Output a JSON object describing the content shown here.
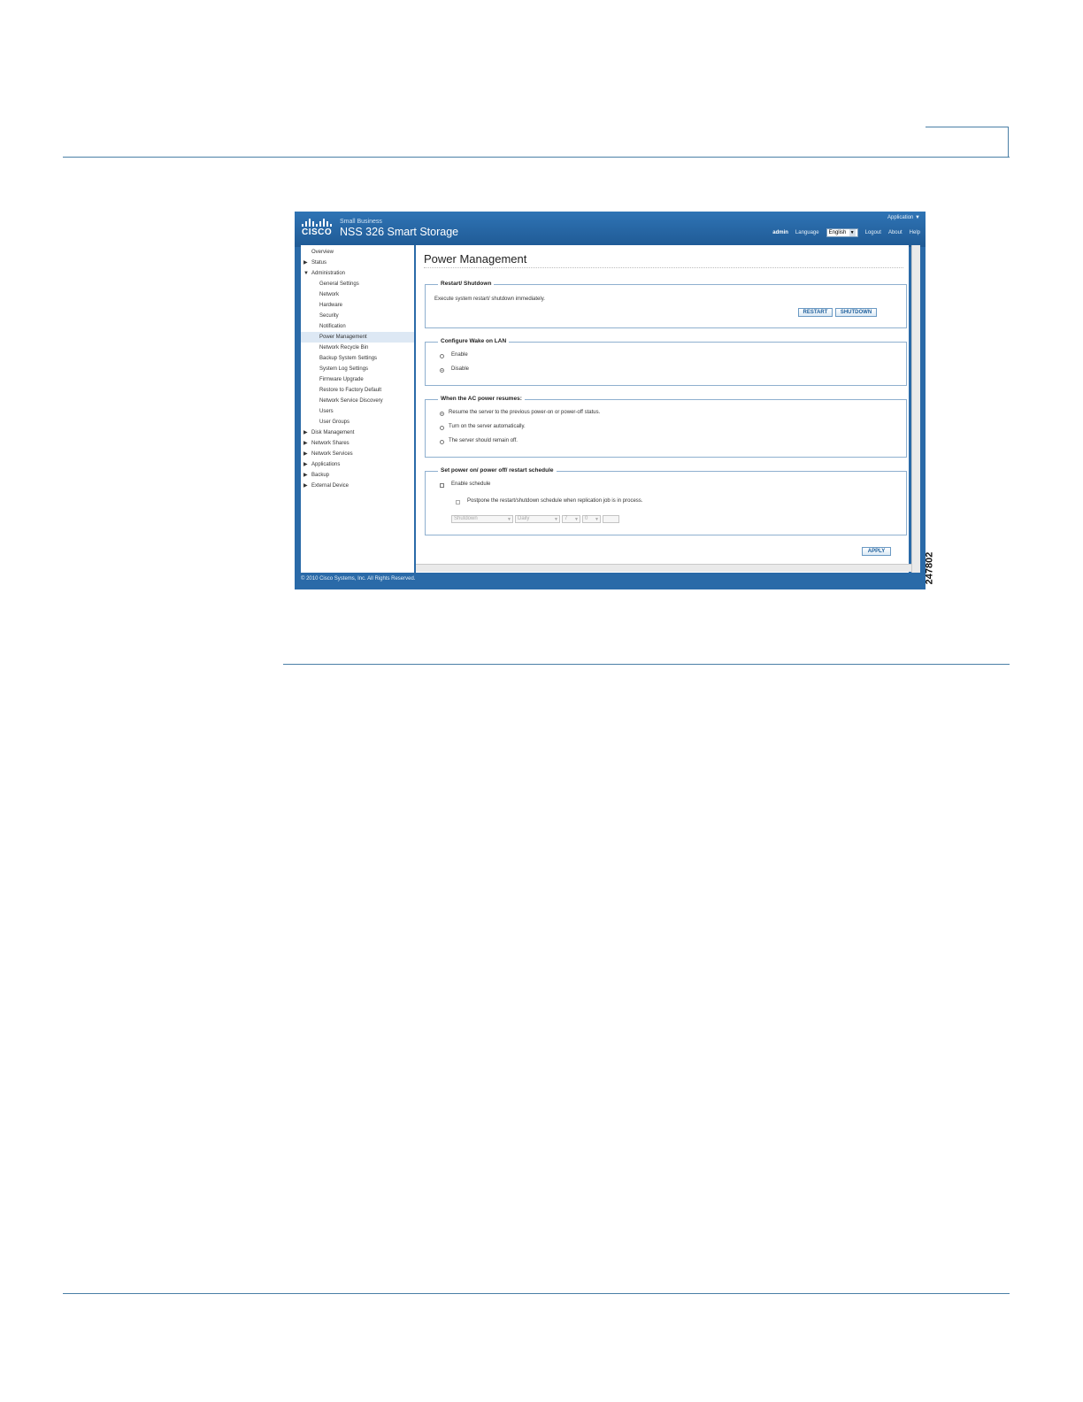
{
  "app": {
    "brand_small": "Small Business",
    "brand_title": "NSS 326 Smart Storage",
    "application_menu": "Application ▼",
    "user": "admin",
    "language_label": "Language",
    "language_value": "English",
    "logout": "Logout",
    "about": "About",
    "help": "Help",
    "logo_word": "CISCO"
  },
  "sidebar": {
    "items": [
      {
        "label": "Overview",
        "level": 0,
        "icon": ""
      },
      {
        "label": "Status",
        "level": 0,
        "icon": "triangle-right"
      },
      {
        "label": "Administration",
        "level": 0,
        "icon": "triangle-down"
      },
      {
        "label": "General Settings",
        "level": 1
      },
      {
        "label": "Network",
        "level": 1
      },
      {
        "label": "Hardware",
        "level": 1
      },
      {
        "label": "Security",
        "level": 1
      },
      {
        "label": "Notification",
        "level": 1
      },
      {
        "label": "Power Management",
        "level": 1,
        "active": true
      },
      {
        "label": "Network Recycle Bin",
        "level": 1
      },
      {
        "label": "Backup System Settings",
        "level": 1
      },
      {
        "label": "System Log Settings",
        "level": 1
      },
      {
        "label": "Firmware Upgrade",
        "level": 1
      },
      {
        "label": "Restore to Factory Default",
        "level": 1
      },
      {
        "label": "Network Service Discovery",
        "level": 1
      },
      {
        "label": "Users",
        "level": 1
      },
      {
        "label": "User Groups",
        "level": 1
      },
      {
        "label": "Disk Management",
        "level": 0,
        "icon": "triangle-right"
      },
      {
        "label": "Network Shares",
        "level": 0,
        "icon": "triangle-right"
      },
      {
        "label": "Network Services",
        "level": 0,
        "icon": "triangle-right"
      },
      {
        "label": "Applications",
        "level": 0,
        "icon": "triangle-right"
      },
      {
        "label": "Backup",
        "level": 0,
        "icon": "triangle-right"
      },
      {
        "label": "External Device",
        "level": 0,
        "icon": "triangle-right"
      }
    ]
  },
  "main": {
    "title": "Power Management",
    "restart_shutdown": {
      "legend": "Restart/ Shutdown",
      "description": "Execute system restart/ shutdown immediately.",
      "restart_label": "RESTART",
      "shutdown_label": "SHUTDOWN"
    },
    "wake_on_lan": {
      "legend": "Configure Wake on LAN",
      "options": [
        "Enable",
        "Disable"
      ],
      "selected": "Disable"
    },
    "ac_power": {
      "legend": "When the AC power resumes:",
      "options": [
        "Resume the server to the previous power-on or power-off status.",
        "Turn on the server automatically.",
        "The server should remain off."
      ],
      "selected": "Resume the server to the previous power-on or power-off status."
    },
    "schedule": {
      "legend": "Set power on/ power off/ restart schedule",
      "enable_label": "Enable schedule",
      "enable_checked": false,
      "postpone_label": "Postpone the restart/shutdown schedule when replication job is in process.",
      "postpone_checked": false,
      "action_value": "Shutdown",
      "frequency_value": "Daily",
      "hour_value": "7",
      "minute_value": "0"
    },
    "apply_label": "APPLY"
  },
  "footer": "© 2010 Cisco Systems, Inc. All Rights Reserved.",
  "figure_id": "247802",
  "colors": {
    "header_blue": "#2a6aa8",
    "button_text": "#1a5d9b",
    "rule": "#4a7fa6"
  }
}
